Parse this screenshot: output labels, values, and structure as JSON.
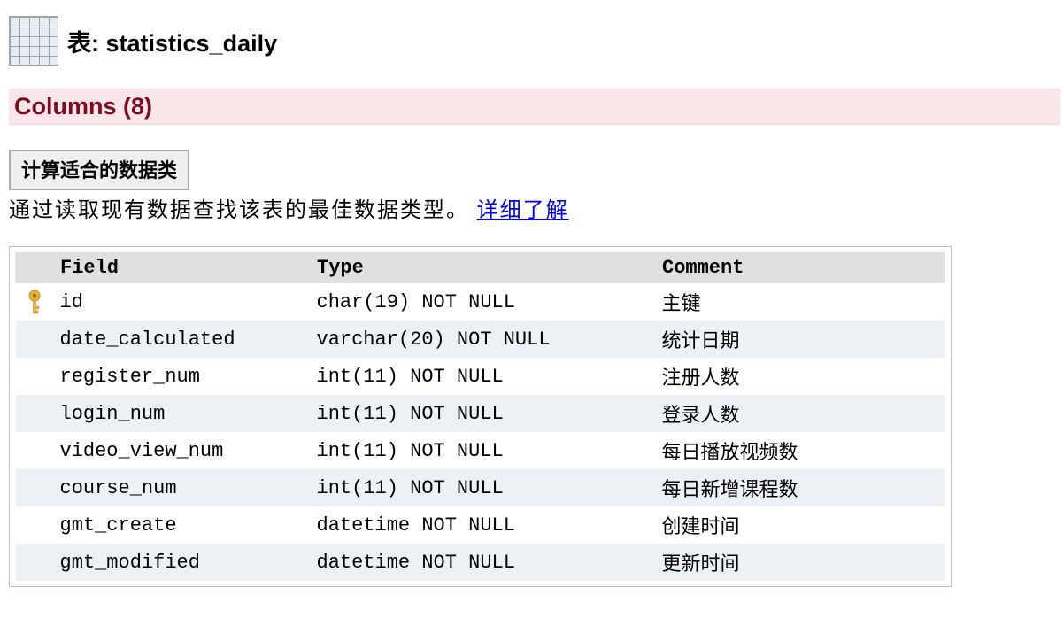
{
  "header": {
    "prefix": "表: ",
    "table_name": "statistics_daily"
  },
  "columns_section": {
    "label_prefix": "Columns (",
    "count": "8",
    "label_suffix": ")"
  },
  "optimize": {
    "button_label": "计算适合的数据类",
    "description": "通过读取现有数据查找该表的最佳数据类型。 ",
    "link_label": "详细了解"
  },
  "table": {
    "headers": {
      "field": "Field",
      "type": "Type",
      "comment": "Comment"
    },
    "rows": [
      {
        "is_pk": true,
        "field": "id",
        "type": "char(19) NOT NULL",
        "comment": "主键"
      },
      {
        "is_pk": false,
        "field": "date_calculated",
        "type": "varchar(20) NOT NULL",
        "comment": "统计日期"
      },
      {
        "is_pk": false,
        "field": "register_num",
        "type": "int(11) NOT NULL",
        "comment": "注册人数"
      },
      {
        "is_pk": false,
        "field": "login_num",
        "type": "int(11) NOT NULL",
        "comment": "登录人数"
      },
      {
        "is_pk": false,
        "field": "video_view_num",
        "type": "int(11) NOT NULL",
        "comment": "每日播放视频数"
      },
      {
        "is_pk": false,
        "field": "course_num",
        "type": "int(11) NOT NULL",
        "comment": "每日新增课程数"
      },
      {
        "is_pk": false,
        "field": "gmt_create",
        "type": "datetime NOT NULL",
        "comment": "创建时间"
      },
      {
        "is_pk": false,
        "field": "gmt_modified",
        "type": "datetime NOT NULL",
        "comment": "更新时间"
      }
    ]
  }
}
